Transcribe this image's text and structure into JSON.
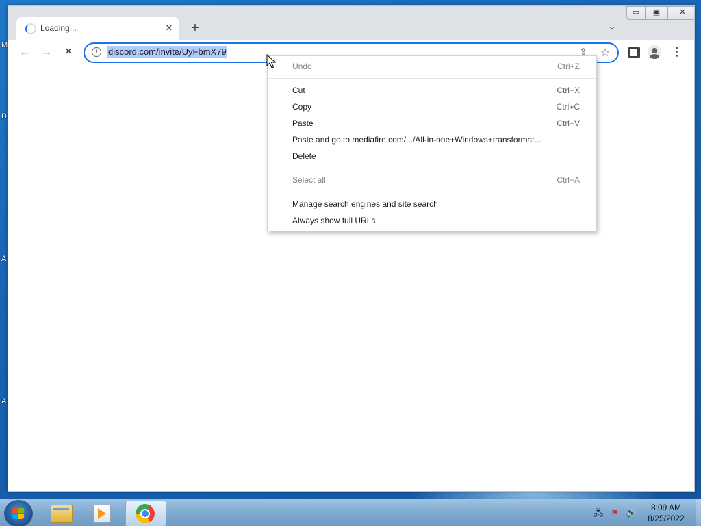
{
  "browser": {
    "tab": {
      "title": "Loading...",
      "close": "✕"
    },
    "newtab": "+",
    "tabsearch": "⌄",
    "window_controls": {
      "minimize": "▭",
      "restore": "▣",
      "close": "✕"
    },
    "nav": {
      "back": "←",
      "forward": "→",
      "stop": "✕"
    },
    "address": {
      "url": "discord.com/invite/UyFbmX79",
      "info": "i"
    },
    "omni_actions": {
      "share": "⇪",
      "bookmark": "☆"
    },
    "menu_button": "⋮"
  },
  "context_menu": {
    "items": [
      {
        "label": "Undo",
        "shortcut": "Ctrl+Z",
        "disabled": true
      },
      {
        "label": "Cut",
        "shortcut": "Ctrl+X",
        "disabled": false
      },
      {
        "label": "Copy",
        "shortcut": "Ctrl+C",
        "disabled": false
      },
      {
        "label": "Paste",
        "shortcut": "Ctrl+V",
        "disabled": false
      },
      {
        "label": "Paste and go to mediafire.com/.../All-in-one+Windows+transformat...",
        "shortcut": "",
        "disabled": false
      },
      {
        "label": "Delete",
        "shortcut": "",
        "disabled": false
      },
      {
        "label": "Select all",
        "shortcut": "Ctrl+A",
        "disabled": true
      },
      {
        "label": "Manage search engines and site search",
        "shortcut": "",
        "disabled": false
      },
      {
        "label": "Always show full URLs",
        "shortcut": "",
        "disabled": false
      }
    ]
  },
  "desktop": {
    "edge_letters": [
      "M",
      "D",
      "A",
      "A"
    ]
  },
  "taskbar": {
    "tray": {
      "network": "🖧",
      "flag": "⚑",
      "volume": "🔊"
    },
    "clock": {
      "time": "8:09 AM",
      "date": "8/25/2022"
    }
  },
  "colors": {
    "accent": "#1a73e8",
    "selection": "#aecbfa",
    "tabstrip": "#dee1e6"
  }
}
